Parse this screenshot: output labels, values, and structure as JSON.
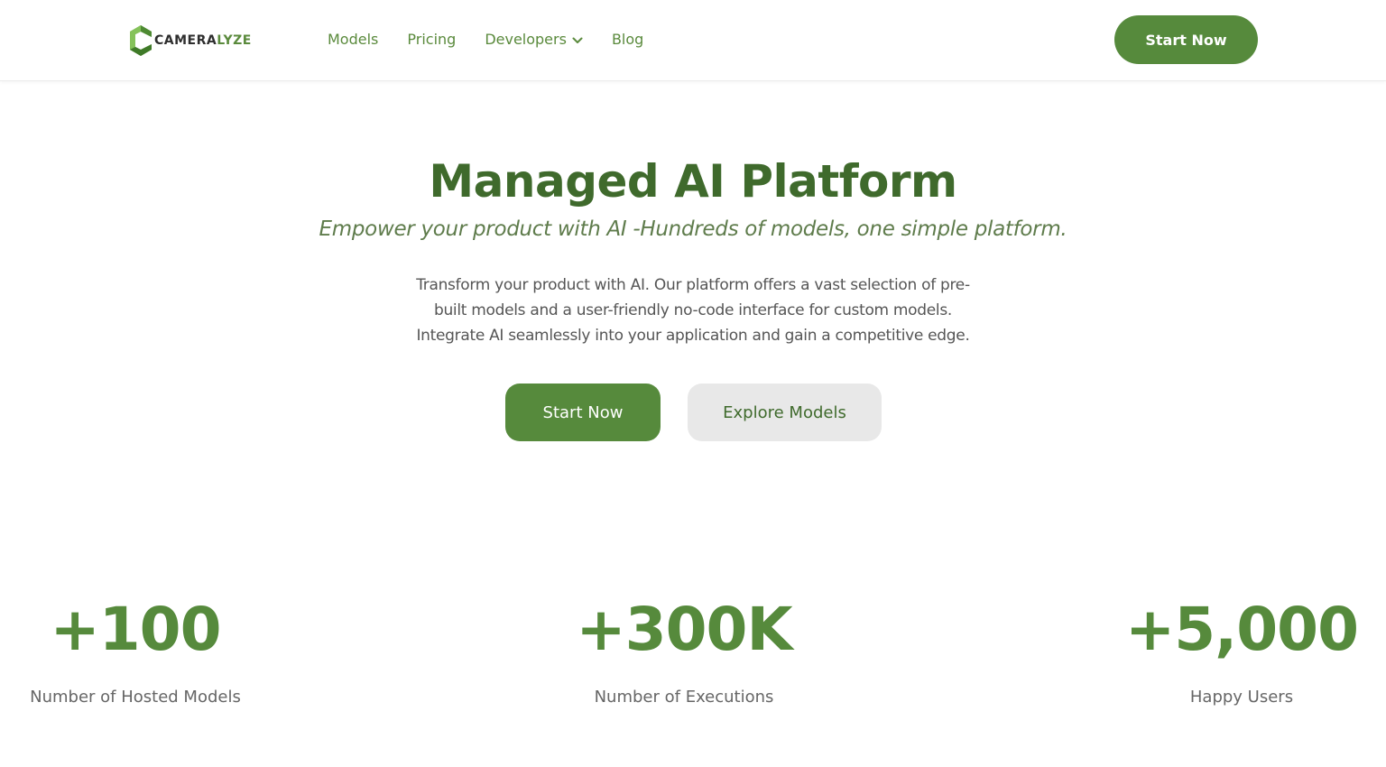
{
  "header": {
    "logo": {
      "text_dark": "CAMERA",
      "text_green": "LYZE",
      "icon": "hexagon-c-logo-icon"
    },
    "nav": [
      {
        "label": "Models"
      },
      {
        "label": "Pricing"
      },
      {
        "label": "Developers",
        "icon": "chevron-down-icon"
      },
      {
        "label": "Blog"
      }
    ],
    "cta_label": "Start Now"
  },
  "hero": {
    "title": "Managed AI Platform",
    "subtitle": "Empower your product with AI -Hundreds of models, one simple platform.",
    "description": [
      "Transform your product with AI. Our platform offers a vast selection of pre-",
      "built models and a user-friendly no-code interface for custom models.",
      "Integrate AI seamlessly into your application and gain a competitive edge."
    ],
    "primary_button": "Start Now",
    "secondary_button": "Explore Models"
  },
  "stats": [
    {
      "value": "+100",
      "label": "Number of Hosted Models"
    },
    {
      "value": "+300K",
      "label": "Number of Executions"
    },
    {
      "value": "+5,000",
      "label": "Happy Users"
    }
  ],
  "colors": {
    "brand_green": "#568a3c",
    "title_green": "#3f6a2c",
    "secondary_button_bg": "#e8e8e8",
    "body_text": "#555555"
  }
}
